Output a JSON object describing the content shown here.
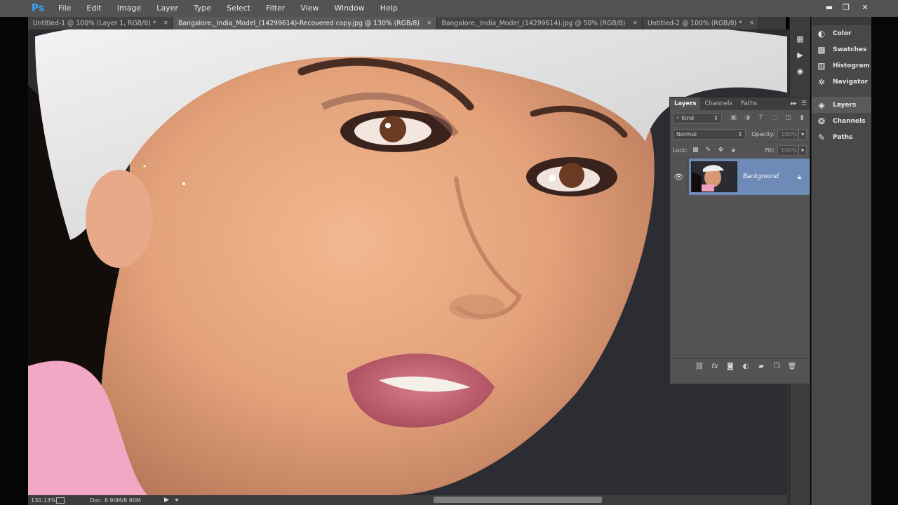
{
  "app": {
    "logo": "Ps"
  },
  "menu": [
    "File",
    "Edit",
    "Image",
    "Layer",
    "Type",
    "Select",
    "Filter",
    "View",
    "Window",
    "Help"
  ],
  "window_controls": {
    "minimize": "▬",
    "restore": "❐",
    "close": "✕"
  },
  "tabs": [
    {
      "label": "Untitled-1 @ 100% (Layer 1, RGB/8) *",
      "active": false
    },
    {
      "label": "Bangalore,_India_Model_(14299614)-Recovered copy.jpg @ 130% (RGB/8)",
      "active": true
    },
    {
      "label": "Bangalore,_India_Model_(14299614).jpg @ 50% (RGB/8)",
      "active": false
    },
    {
      "label": "Untitled-2 @ 100% (RGB/8) *",
      "active": false
    }
  ],
  "tab_close_glyph": "×",
  "status": {
    "zoom": "130.13%",
    "doc": "Doc: 8.90M/8.90M"
  },
  "dock": {
    "group1": [
      {
        "label": "Color",
        "icon": "color-palette-icon"
      },
      {
        "label": "Swatches",
        "icon": "swatches-grid-icon"
      },
      {
        "label": "Histogram",
        "icon": "histogram-icon"
      },
      {
        "label": "Navigator",
        "icon": "navigator-icon"
      }
    ],
    "group2": [
      {
        "label": "Layers",
        "icon": "layers-icon",
        "active": true
      },
      {
        "label": "Channels",
        "icon": "channels-icon"
      },
      {
        "label": "Paths",
        "icon": "paths-icon"
      }
    ]
  },
  "layers_panel": {
    "tabs": [
      "Layers",
      "Channels",
      "Paths"
    ],
    "filter_kind": "Kind",
    "blend_mode": "Normal",
    "opacity_label": "Opacity:",
    "opacity_value": "100%",
    "lock_label": "Lock:",
    "fill_label": "Fill:",
    "fill_value": "100%",
    "layers": [
      {
        "name": "Background",
        "visible": true,
        "locked": true
      }
    ]
  },
  "colors": {
    "menubar": "#535353",
    "panel": "#535353",
    "selected_layer": "#6e8ab7",
    "ps_logo": "#31a8ff"
  }
}
